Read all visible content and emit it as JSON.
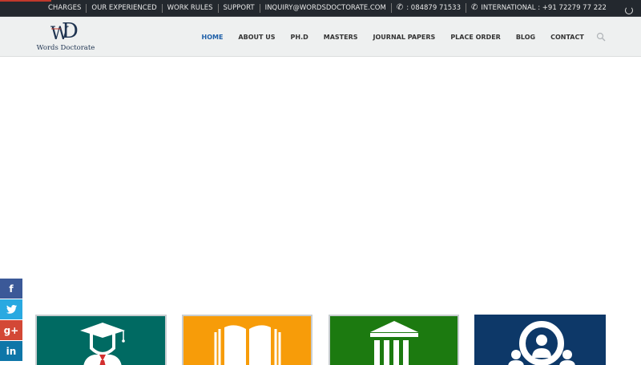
{
  "topbar": {
    "links": [
      {
        "label": "CHARGES"
      },
      {
        "label": "OUR EXPERIENCED"
      },
      {
        "label": "WORK RULES"
      },
      {
        "label": "SUPPORT"
      },
      {
        "label": "INQUIRY@WORDSDOCTORATE.COM"
      }
    ],
    "phone_local": ": 084879 71533",
    "phone_intl": "INTERNATIONAL : +91 72279 77 222",
    "phone_icon": "phone-icon"
  },
  "header": {
    "logo_text": "Words Doctorate",
    "nav": [
      {
        "label": "HOME",
        "active": true
      },
      {
        "label": "ABOUT US"
      },
      {
        "label": "PH.D"
      },
      {
        "label": "MASTERS"
      },
      {
        "label": "JOURNAL PAPERS"
      },
      {
        "label": "PLACE ORDER"
      },
      {
        "label": "BLOG"
      },
      {
        "label": "CONTACT"
      }
    ],
    "search_icon": "search-icon"
  },
  "social": {
    "facebook": "f",
    "twitter": "t",
    "googleplus": "g+",
    "linkedin": "in"
  },
  "tiles": [
    {
      "icon": "graduate-icon",
      "color": "#006a62"
    },
    {
      "icon": "open-book-icon",
      "color": "#f79c09"
    },
    {
      "icon": "institution-icon",
      "color": "#1c7a10"
    },
    {
      "icon": "team-icon",
      "color": "#0d3868"
    }
  ]
}
